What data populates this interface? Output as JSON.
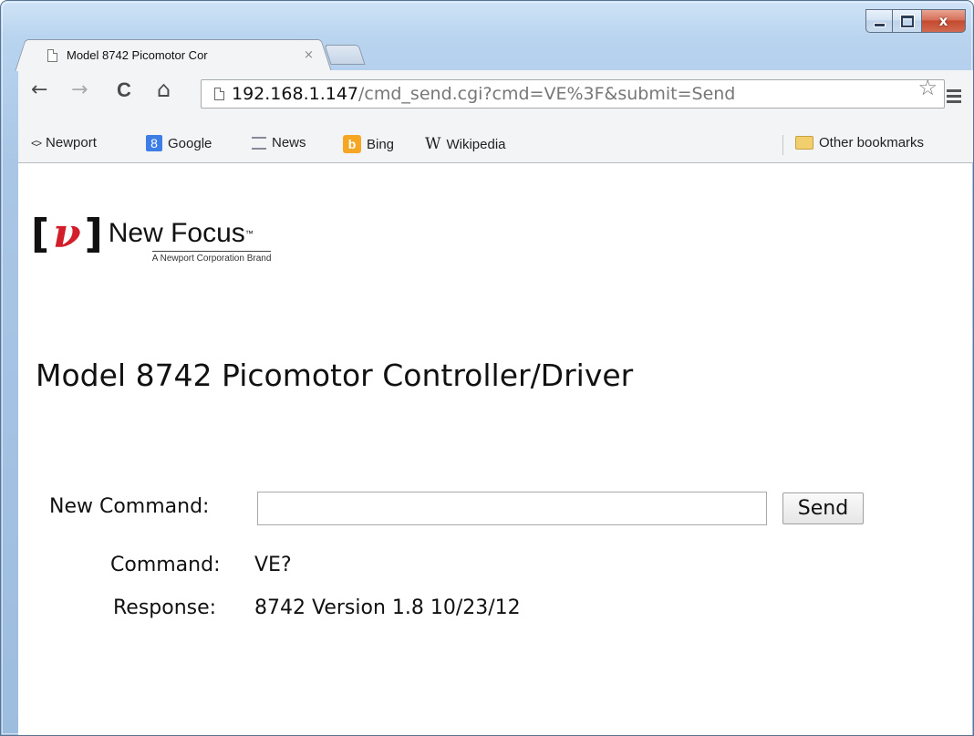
{
  "browser": {
    "tab": {
      "title": "Model 8742 Picomotor Cor",
      "close": "×"
    },
    "nav": {
      "back": "←",
      "forward": "→",
      "reload": "C",
      "home": "⌂"
    },
    "url": {
      "host": "192.168.1.147",
      "path": "/cmd_send.cgi?cmd=VE%3F&submit=Send"
    },
    "star": "☆",
    "window_controls": {
      "close": "x"
    },
    "bookmarks": [
      {
        "label": "Newport",
        "icon": "newport-icon"
      },
      {
        "label": "Google",
        "icon": "google-icon"
      },
      {
        "label": "News",
        "icon": "news-icon"
      },
      {
        "label": "Bing",
        "icon": "bing-icon"
      },
      {
        "label": "Wikipedia",
        "icon": "wikipedia-icon"
      }
    ],
    "other_bookmarks": "Other bookmarks"
  },
  "logo": {
    "mark": "ν",
    "name": "New Focus",
    "tm": "™",
    "subtitle": "A Newport Corporation Brand"
  },
  "page": {
    "title": "Model 8742 Picomotor Controller/Driver",
    "form": {
      "new_command_label": "New Command:",
      "input_value": "",
      "send_label": "Send"
    },
    "result": {
      "command_label": "Command:",
      "command_value": "VE?",
      "response_label": "Response:",
      "response_value": "8742 Version 1.8 10/23/12"
    }
  },
  "colors": {
    "frame": "#a9c6e6",
    "logo_red": "#d21d2a",
    "bing": "#f5a623",
    "google": "#3d7ee6"
  }
}
